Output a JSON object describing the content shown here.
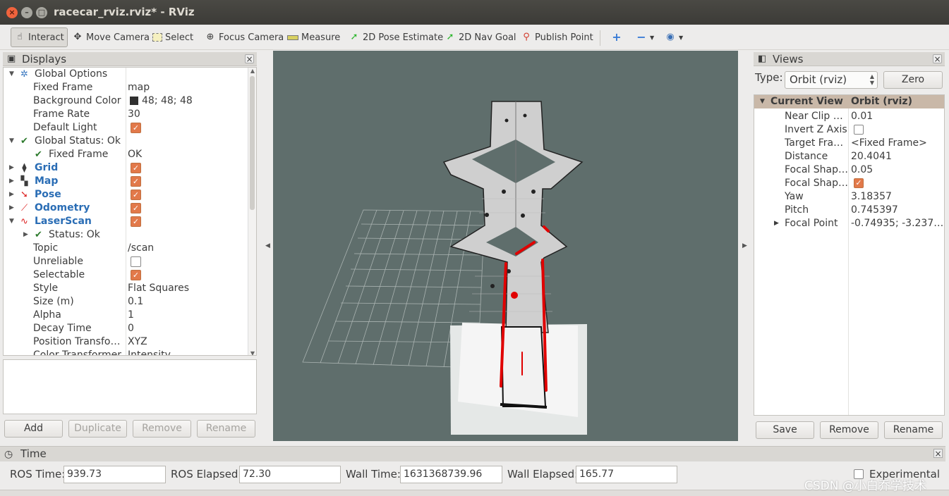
{
  "window": {
    "title": "racecar_rviz.rviz* - RViz"
  },
  "toolbar": {
    "tools": [
      {
        "label": "Interact",
        "icon": "cursor-hand-icon"
      },
      {
        "label": "Move Camera",
        "icon": "move-arrows-icon"
      },
      {
        "label": "Select",
        "icon": "select-box-icon"
      },
      {
        "label": "Focus Camera",
        "icon": "crosshair-icon"
      },
      {
        "label": "Measure",
        "icon": "ruler-icon"
      },
      {
        "label": "2D Pose Estimate",
        "icon": "green-arrow-icon"
      },
      {
        "label": "2D Nav Goal",
        "icon": "green-arrow-icon"
      },
      {
        "label": "Publish Point",
        "icon": "red-pin-icon"
      }
    ]
  },
  "displays": {
    "title": "Displays",
    "rows": [
      {
        "name": "Global Options",
        "value": ""
      },
      {
        "name": "Fixed Frame",
        "value": "map"
      },
      {
        "name": "Background Color",
        "value": "48; 48; 48"
      },
      {
        "name": "Frame Rate",
        "value": "30"
      },
      {
        "name": "Default Light",
        "value": ""
      },
      {
        "name": "Global Status: Ok",
        "value": ""
      },
      {
        "name": "Fixed Frame",
        "value": "OK"
      },
      {
        "name": "Grid",
        "value": ""
      },
      {
        "name": "Map",
        "value": ""
      },
      {
        "name": "Pose",
        "value": ""
      },
      {
        "name": "Odometry",
        "value": ""
      },
      {
        "name": "LaserScan",
        "value": ""
      },
      {
        "name": "Status: Ok",
        "value": ""
      },
      {
        "name": "Topic",
        "value": "/scan"
      },
      {
        "name": "Unreliable",
        "value": ""
      },
      {
        "name": "Selectable",
        "value": ""
      },
      {
        "name": "Style",
        "value": "Flat Squares"
      },
      {
        "name": "Size (m)",
        "value": "0.1"
      },
      {
        "name": "Alpha",
        "value": "1"
      },
      {
        "name": "Decay Time",
        "value": "0"
      },
      {
        "name": "Position Transfo…",
        "value": "XYZ"
      },
      {
        "name": "Color Transformer",
        "value": "Intensity"
      }
    ],
    "buttons": {
      "add": "Add",
      "duplicate": "Duplicate",
      "remove": "Remove",
      "rename": "Rename"
    }
  },
  "views": {
    "title": "Views",
    "type_label": "Type:",
    "type_value": "Orbit (rviz)",
    "zero_label": "Zero",
    "header": {
      "name": "Current View",
      "value": "Orbit (rviz)"
    },
    "rows": [
      {
        "name": "Near Clip …",
        "value": "0.01"
      },
      {
        "name": "Invert Z Axis",
        "value": ""
      },
      {
        "name": "Target Fra…",
        "value": "<Fixed Frame>"
      },
      {
        "name": "Distance",
        "value": "20.4041"
      },
      {
        "name": "Focal Shap…",
        "value": "0.05"
      },
      {
        "name": "Focal Shap…",
        "value": ""
      },
      {
        "name": "Yaw",
        "value": "3.18357"
      },
      {
        "name": "Pitch",
        "value": "0.745397"
      },
      {
        "name": "Focal Point",
        "value": "-0.74935; -3.237…"
      }
    ],
    "buttons": {
      "save": "Save",
      "remove": "Remove",
      "rename": "Rename"
    }
  },
  "time": {
    "title": "Time",
    "ros_time_label": "ROS Time:",
    "ros_time": "939.73",
    "ros_elapsed_label": "ROS Elapsed:",
    "ros_elapsed": "72.30",
    "wall_time_label": "Wall Time:",
    "wall_time": "1631368739.96",
    "wall_elapsed_label": "Wall Elapsed:",
    "wall_elapsed": "165.77",
    "experimental_label": "Experimental"
  },
  "watermark": "CSDN @小白乔学技术",
  "colors": {
    "accent_check": "#e2794a",
    "view_background": "#5f6e6c",
    "laser": "#e00000"
  }
}
